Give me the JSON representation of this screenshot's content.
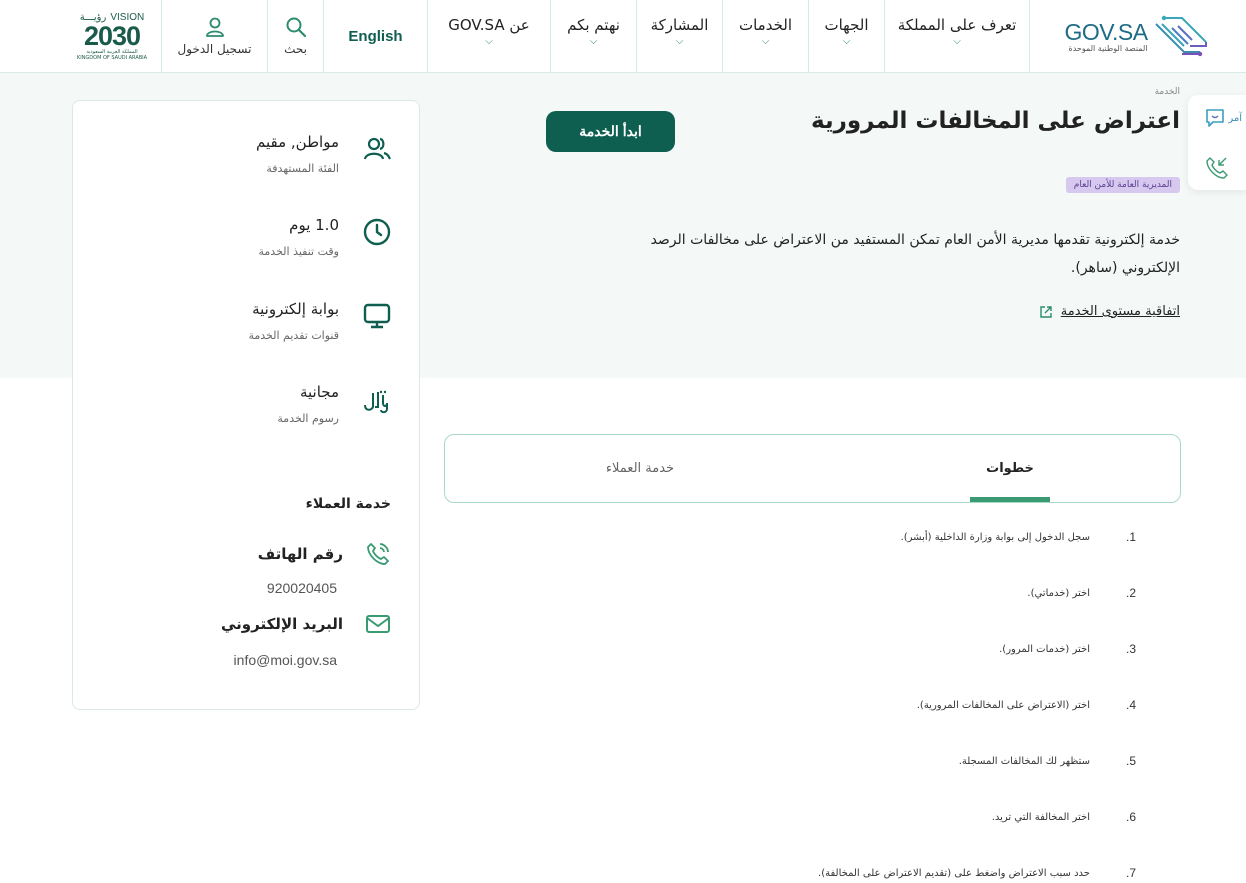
{
  "header": {
    "logo": {
      "main": "GOV.SA",
      "sub": "المنصة الوطنية الموحدة"
    },
    "nav": [
      {
        "label": "تعرف على المملكة"
      },
      {
        "label": "الجهات"
      },
      {
        "label": "الخدمات"
      },
      {
        "label": "المشاركة"
      },
      {
        "label": "نهتم بكم"
      },
      {
        "label": "عن GOV.SA"
      }
    ],
    "language": "English",
    "search_label": "بحث",
    "login_label": "تسجيل الدخول",
    "vision": {
      "top_en": "VISION",
      "top_ar": "رؤيـــة",
      "number": "2030",
      "sub_ar": "المملكة العربية السعودية",
      "sub_en": "KINGDOM OF SAUDI ARABIA"
    }
  },
  "hero": {
    "breadcrumb": "الخدمة",
    "title": "اعتراض على المخالفات المرورية",
    "start_button": "ابدأ الخدمة",
    "agency": "المديرية العامة للأمن العام",
    "description": "خدمة إلكترونية تقدمها مديرية الأمن العام تمكن المستفيد من الاعتراض على مخالفات الرصد الإلكتروني (ساهر).",
    "sla_link": "اتفاقية مستوى الخدمة"
  },
  "side_widget": {
    "amr_label": "آمر"
  },
  "info_card": {
    "items": [
      {
        "icon": "users-icon",
        "value": "مواطن, مقيم",
        "label": "الفئة المستهدفة"
      },
      {
        "icon": "clock-icon",
        "value": "1.0 يوم",
        "label": "وقت تنفيذ الخدمة"
      },
      {
        "icon": "monitor-icon",
        "value": "بوابة إلكترونية",
        "label": "قنوات تقديم الخدمة"
      },
      {
        "icon": "riyal-icon",
        "value": "مجانية",
        "label": "رسوم الخدمة"
      }
    ],
    "customer_service": {
      "title": "خدمة العملاء",
      "phone_label": "رقم الهاتف",
      "phone": "920020405",
      "email_label": "البريد الإلكتروني",
      "email": "info@moi.gov.sa"
    }
  },
  "tabs": [
    {
      "label": "خطوات",
      "active": true
    },
    {
      "label": "خدمة العملاء",
      "active": false
    }
  ],
  "steps": [
    {
      "num": "1.",
      "text": "سجل الدخول إلى بوابة وزارة الداخلية (أبشر)."
    },
    {
      "num": "2.",
      "text": "اختر (خدماتي)."
    },
    {
      "num": "3.",
      "text": "اختر (خدمات المرور)."
    },
    {
      "num": "4.",
      "text": "اختر (الاعتراض على المخالفات المرورية)."
    },
    {
      "num": "5.",
      "text": "ستظهر لك المخالفات المسجلة."
    },
    {
      "num": "6.",
      "text": "اختر المخالفة التي تريد."
    },
    {
      "num": "7.",
      "text": "حدد سبب الاعتراض واضغط على (تقديم الاعتراض على المخالفة)."
    }
  ],
  "colors": {
    "primary": "#0f5f51",
    "accent": "#3a9a72",
    "hero_bg": "#f4f8f7",
    "badge_bg": "#d6c8ef",
    "badge_text": "#5b3f8f"
  }
}
